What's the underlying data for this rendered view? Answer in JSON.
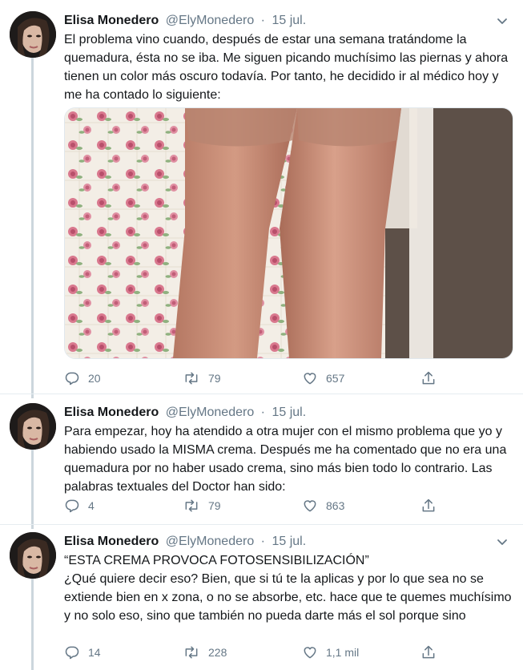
{
  "tweets": [
    {
      "author": "Elisa Monedero",
      "handle": "@ElyMonedero",
      "separator": "·",
      "date": "15 jul.",
      "text": "El problema vino cuando, después de estar una semana tratándome la quemadura, ésta no se iba. Me siguen picando muchísimo las piernas y ahora tienen un color más oscuro todavía. Por tanto, he decidido ir al médico hoy y me ha contado lo siguiente:",
      "replies": "20",
      "retweets": "79",
      "likes": "657"
    },
    {
      "author": "Elisa Monedero",
      "handle": "@ElyMonedero",
      "separator": "·",
      "date": "15 jul.",
      "text": "Para empezar, hoy ha atendido a otra mujer con el mismo problema que yo y habiendo usado la MISMA crema. Después me ha comentado que no era una quemadura por no haber usado crema, sino más bien todo lo contrario. Las palabras textuales del Doctor han sido:",
      "replies": "4",
      "retweets": "79",
      "likes": "863"
    },
    {
      "author": "Elisa Monedero",
      "handle": "@ElyMonedero",
      "separator": "·",
      "date": "15 jul.",
      "text_line1": "“ESTA CREMA PROVOCA FOTOSENSIBILIZACIÓN”",
      "text": "¿Qué quiere decir eso? Bien, que si tú te la aplicas y por lo que sea no se extiende bien en x zona, o no se absorbe, etc. hace que te quemes muchísimo y no solo eso, sino que también no pueda darte más el sol porque sino",
      "replies": "14",
      "retweets": "228",
      "likes": "1,1 mil"
    }
  ],
  "colors": {
    "text": "#14171a",
    "secondary": "#657786",
    "thread_line": "#ccd6dd",
    "divider": "#e6ecf0"
  },
  "icons": [
    "reply-icon",
    "retweet-icon",
    "like-icon",
    "share-icon",
    "chevron-down-icon"
  ]
}
